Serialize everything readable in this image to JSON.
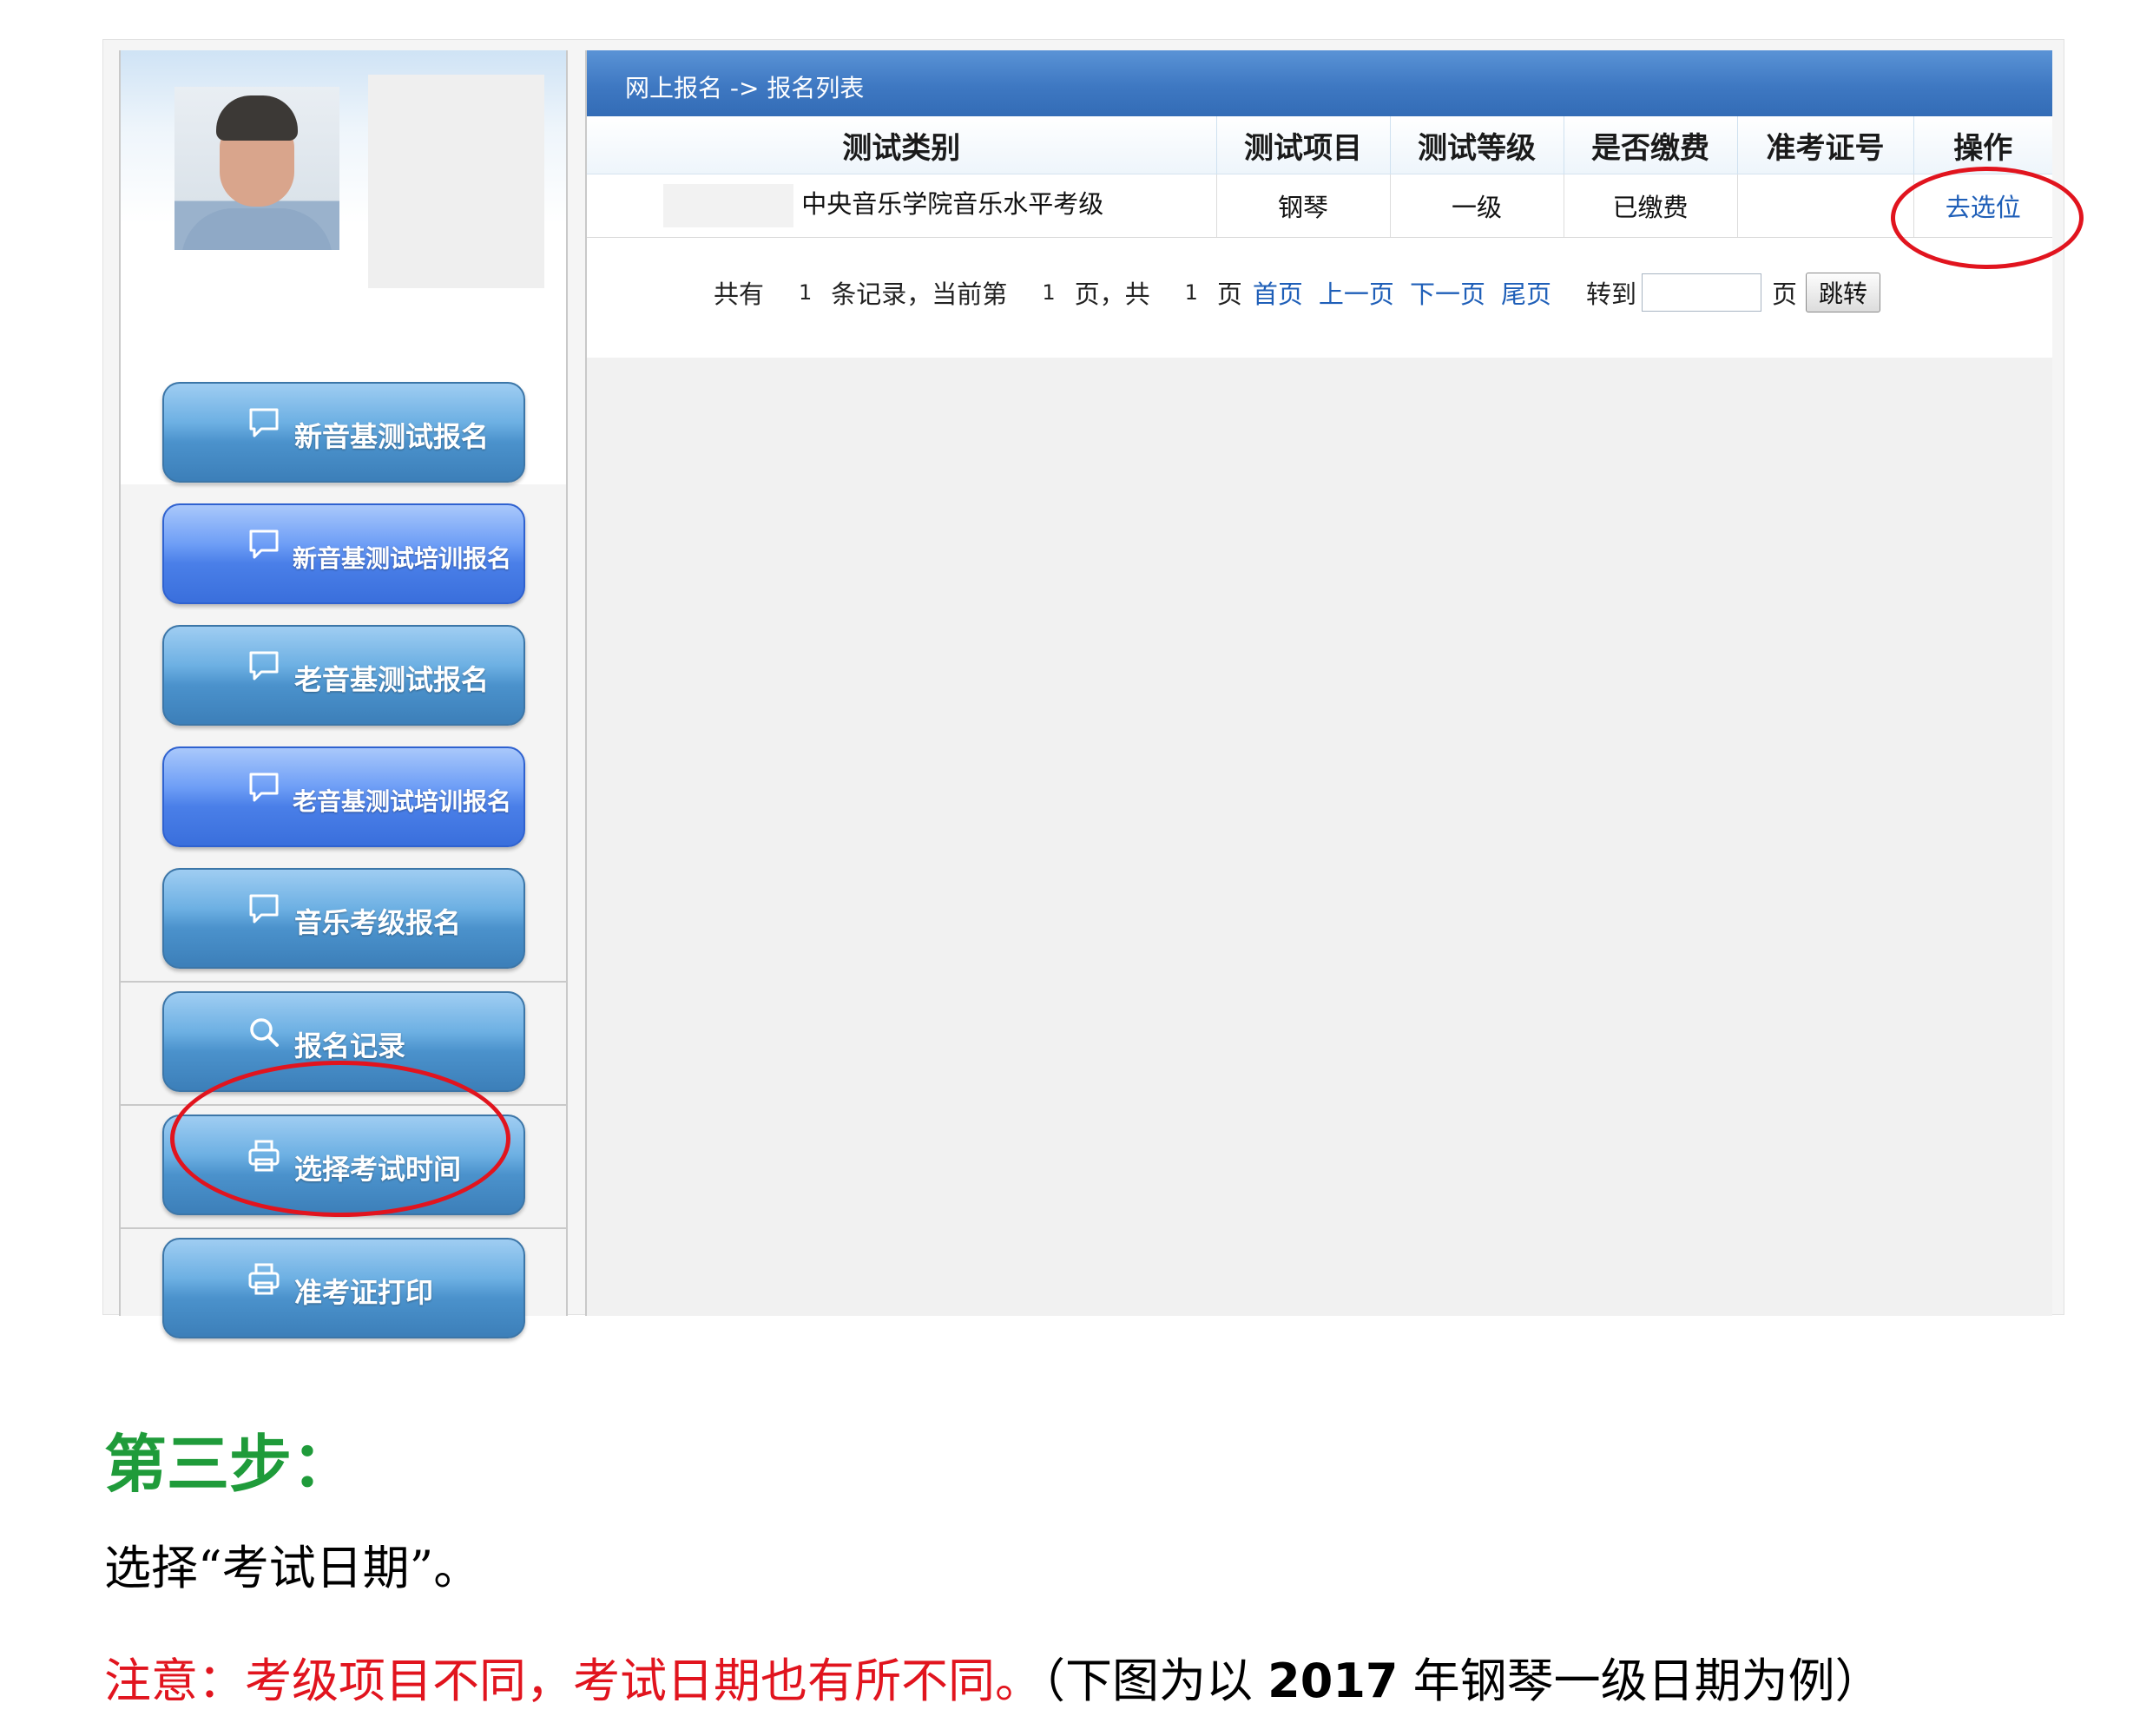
{
  "breadcrumb": "网上报名 -> 报名列表",
  "sidebar": {
    "items": [
      {
        "label": "新音基测试报名",
        "icon": "comment-icon"
      },
      {
        "label": "新音基测试培训报名",
        "icon": "comment-icon"
      },
      {
        "label": "老音基测试报名",
        "icon": "comment-icon"
      },
      {
        "label": "老音基测试培训报名",
        "icon": "comment-icon"
      },
      {
        "label": "音乐考级报名",
        "icon": "comment-icon"
      },
      {
        "label": "报名记录",
        "icon": "search-icon"
      },
      {
        "label": "选择考试时间",
        "icon": "printer-icon"
      },
      {
        "label": "准考证打印",
        "icon": "printer-icon"
      }
    ]
  },
  "table": {
    "headers": [
      "测试类别",
      "测试项目",
      "测试等级",
      "是否缴费",
      "准考证号",
      "操作"
    ],
    "rows": [
      {
        "category": "中央音乐学院音乐水平考级",
        "item": "钢琴",
        "level": "一级",
        "paid": "已缴费",
        "ticket": "",
        "action": "去选位"
      }
    ]
  },
  "pager": {
    "total_prefix": "共有",
    "total_count": "1",
    "records_text": "条记录，当前第",
    "current_page": "1",
    "pages_text": "页，共",
    "total_pages": "1",
    "page_suffix": "页",
    "first": "首页",
    "prev": "上一页",
    "next": "下一页",
    "last": "尾页",
    "goto_label": "转到",
    "goto_value": "",
    "goto_suffix": "页",
    "jump_button": "跳转"
  },
  "doc": {
    "step_title": "第三步：",
    "step_desc": "选择“考试日期”。",
    "note_red": "注意：考级项目不同，考试日期也有所不同。",
    "note_black_pre": "（下图为以",
    "note_year": "2017",
    "note_black_post": "年钢琴一级日期为例）"
  },
  "colors": {
    "header_blue": "#3e78c2",
    "annotation_red": "#e1141e",
    "step_green": "#1f9b3a",
    "link_blue": "#1f5fb8"
  }
}
